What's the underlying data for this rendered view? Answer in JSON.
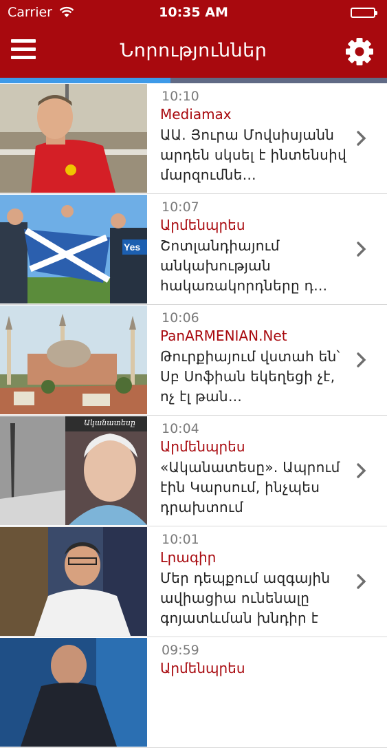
{
  "status_bar": {
    "carrier": "Carrier",
    "time": "10:35 AM",
    "battery_level": 1.0
  },
  "nav": {
    "title": "Նորություններ",
    "menu_icon": "hamburger-icon",
    "settings_icon": "gear-icon"
  },
  "progress": {
    "value": 0.44,
    "track_color": "#606a85",
    "fill_color": "#3e9ae8"
  },
  "colors": {
    "brand": "#a8090e",
    "source_text": "#a8090e",
    "time_text": "#7b7b7b"
  },
  "news": [
    {
      "time": "10:10",
      "source": "Mediamax",
      "headline": "ԱԱ. Յուրա Մովսիսյանն արդեն սկսել է ինտենսիվ մարզումնե…"
    },
    {
      "time": "10:07",
      "source": "Արմենպրես",
      "headline": " Շոտլանդիայում անկախության հակառակորդները դ…"
    },
    {
      "time": "10:06",
      "source": "PanARMENIAN.Net",
      "headline": "Թուրքիայում վստահ են՝ Սբ Սոֆիան եկեղեցի չէ, ոչ էլ թան…"
    },
    {
      "time": "10:04",
      "source": "Արմենպրես",
      "headline": " «Ականատեսը». Ապրում էին Կարսում, ինչպես դրախտում"
    },
    {
      "time": "10:01",
      "source": "Լրագիր",
      "headline": " Մեր դեպքում ազգային ավիացիա ունենալը գոյատևման խնդիր է"
    },
    {
      "time": "09:59",
      "source": "Արմենպրես",
      "headline": ""
    }
  ],
  "thumb_captions": {
    "row4_watermark": "Ականատեսը"
  }
}
